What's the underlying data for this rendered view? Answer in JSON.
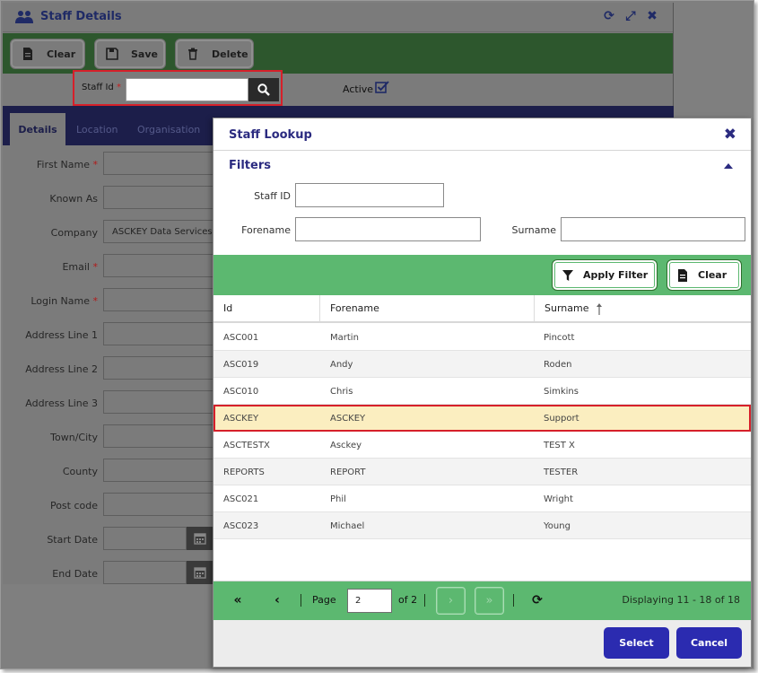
{
  "background_window": {
    "title": "Staff Details",
    "toolbar": {
      "clear_label": "Clear",
      "save_label": "Save",
      "delete_label": "Delete"
    },
    "staff_id_label": "Staff Id",
    "required_mark": "*",
    "active_label": "Active",
    "tabs": [
      "Details",
      "Location",
      "Organisation"
    ],
    "fields": [
      {
        "label": "First Name",
        "required": true,
        "value": ""
      },
      {
        "label": "Known As",
        "required": false,
        "value": ""
      },
      {
        "label": "Company",
        "required": false,
        "value": "ASCKEY Data Services"
      },
      {
        "label": "Email",
        "required": true,
        "value": ""
      },
      {
        "label": "Login Name",
        "required": true,
        "value": ""
      },
      {
        "label": "Address Line 1",
        "required": false,
        "value": ""
      },
      {
        "label": "Address Line 2",
        "required": false,
        "value": ""
      },
      {
        "label": "Address Line 3",
        "required": false,
        "value": ""
      },
      {
        "label": "Town/City",
        "required": false,
        "value": ""
      },
      {
        "label": "County",
        "required": false,
        "value": ""
      },
      {
        "label": "Post code",
        "required": false,
        "value": ""
      },
      {
        "label": "Start Date",
        "required": false,
        "value": "",
        "calendar": true
      },
      {
        "label": "End Date",
        "required": false,
        "value": "",
        "calendar": true
      }
    ]
  },
  "modal": {
    "title": "Staff Lookup",
    "filters_header": "Filters",
    "staff_id_label": "Staff ID",
    "forename_label": "Forename",
    "surname_label": "Surname",
    "apply_filter_label": "Apply Filter",
    "clear_label": "Clear",
    "columns": [
      "Id",
      "Forename",
      "Surname"
    ],
    "rows": [
      {
        "id": "ASC001",
        "forename": "Martin",
        "surname": "Pincott"
      },
      {
        "id": "ASC019",
        "forename": "Andy",
        "surname": "Roden"
      },
      {
        "id": "ASC010",
        "forename": "Chris",
        "surname": "Simkins"
      },
      {
        "id": "ASCKEY",
        "forename": "ASCKEY",
        "surname": "Support"
      },
      {
        "id": "ASCTESTX",
        "forename": "Asckey",
        "surname": "TEST X"
      },
      {
        "id": "REPORTS",
        "forename": "REPORT",
        "surname": "TESTER"
      },
      {
        "id": "ASC021",
        "forename": "Phil",
        "surname": "Wright"
      },
      {
        "id": "ASC023",
        "forename": "Michael",
        "surname": "Young"
      }
    ],
    "selected_row_index": 3,
    "pager": {
      "page_label": "Page",
      "page_value": "2",
      "of_label": "of 2",
      "display_text": "Displaying 11 - 18 of 18"
    },
    "select_label": "Select",
    "cancel_label": "Cancel"
  }
}
